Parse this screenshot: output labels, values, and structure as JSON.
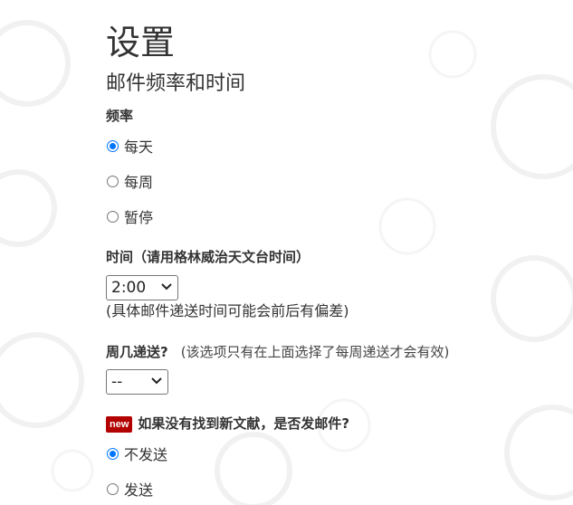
{
  "page": {
    "title": "设置",
    "section_title": "邮件频率和时间"
  },
  "frequency": {
    "label": "频率",
    "options": [
      {
        "label": "每天",
        "checked": true
      },
      {
        "label": "每周",
        "checked": false
      },
      {
        "label": "暂停",
        "checked": false
      }
    ]
  },
  "time": {
    "label": "时间（请用格林威治天文台时间）",
    "selected": "2:00",
    "hint": "(具体邮件递送时间可能会前后有偏差)"
  },
  "weekday": {
    "label": "周几递送?",
    "note": "(该选项只有在上面选择了每周递送才会有效)",
    "selected": "--"
  },
  "send_if_none": {
    "badge": "new",
    "label": "如果没有找到新文献，是否发邮件?",
    "options": [
      {
        "label": "不发送",
        "checked": true
      },
      {
        "label": "发送",
        "checked": false
      }
    ]
  },
  "colors": {
    "accent": "#0075ff",
    "badge": "#b30000",
    "text": "#333333"
  }
}
